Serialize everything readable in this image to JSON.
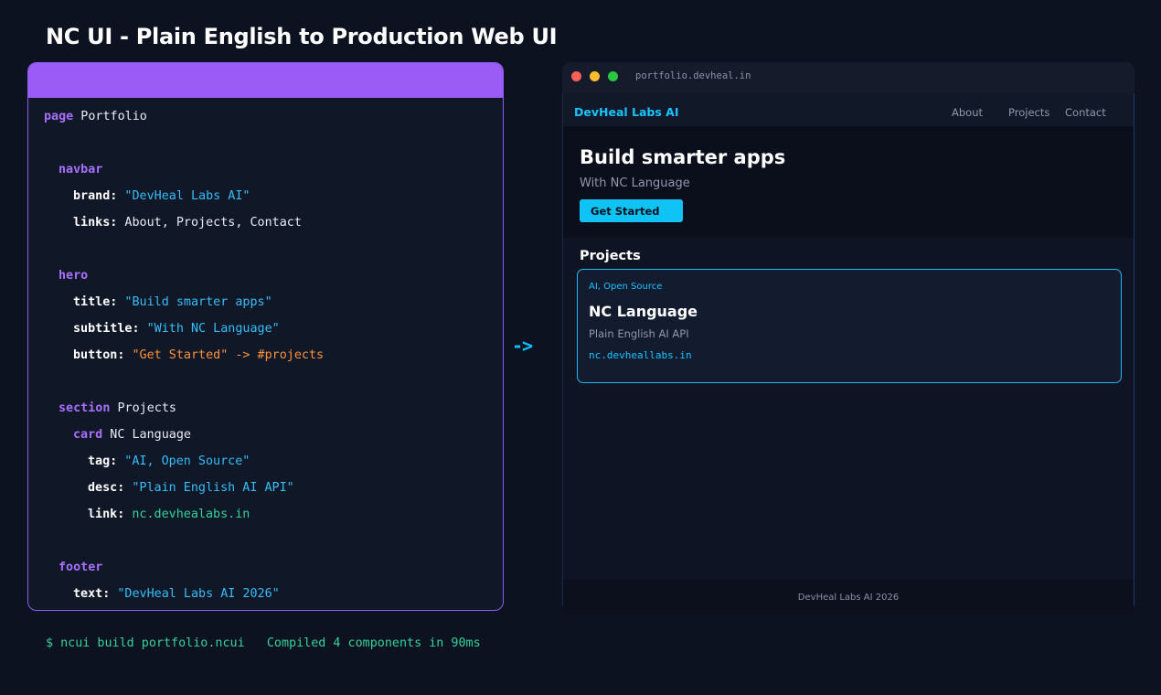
{
  "page_title": "NC UI - Plain English to Production Web UI",
  "editor": {
    "lines": [
      {
        "kw": "page",
        "rest": " Portfolio"
      },
      {
        "kw": "navbar"
      },
      {
        "key": "brand:",
        "str": " \"DevHeal Labs AI\""
      },
      {
        "key": "links:",
        "plain": " About, Projects, Contact"
      },
      {
        "kw": "hero"
      },
      {
        "key": "title:",
        "str": " \"Build smarter apps\""
      },
      {
        "key": "subtitle:",
        "str": " \"With NC Language\""
      },
      {
        "key": "button:",
        "orange": " \"Get Started\" -> #projects"
      },
      {
        "kw": "section",
        "rest": " Projects"
      },
      {
        "kw": "card",
        "rest": " NC Language"
      },
      {
        "key": "tag:",
        "str": " \"AI, Open Source\""
      },
      {
        "key": "desc:",
        "str": " \"Plain English AI API\""
      },
      {
        "key": "link:",
        "green": " nc.devhealabs.in"
      },
      {
        "kw": "footer"
      },
      {
        "key": "text:",
        "str": " \"DevHeal Labs AI 2026\""
      }
    ]
  },
  "arrow": "->",
  "terminal": "$ ncui build portfolio.ncui   Compiled 4 components in 90ms",
  "browser": {
    "url": "portfolio.devheal.in",
    "brand": "DevHeal Labs AI",
    "nav_links": [
      "About",
      "Projects",
      "Contact"
    ],
    "hero": {
      "title": "Build smarter apps",
      "subtitle": "With NC Language",
      "button": "Get Started"
    },
    "section_title": "Projects",
    "card": {
      "tag": "AI, Open Source",
      "title": "NC Language",
      "desc": "Plain English AI API",
      "link": "nc.devheallabs.in"
    },
    "footer": "DevHeal Labs AI 2026"
  },
  "colors": {
    "accent_purple": "#9b5cf6",
    "accent_cyan": "#19c3ff",
    "green": "#34d399",
    "orange": "#fb923c"
  }
}
